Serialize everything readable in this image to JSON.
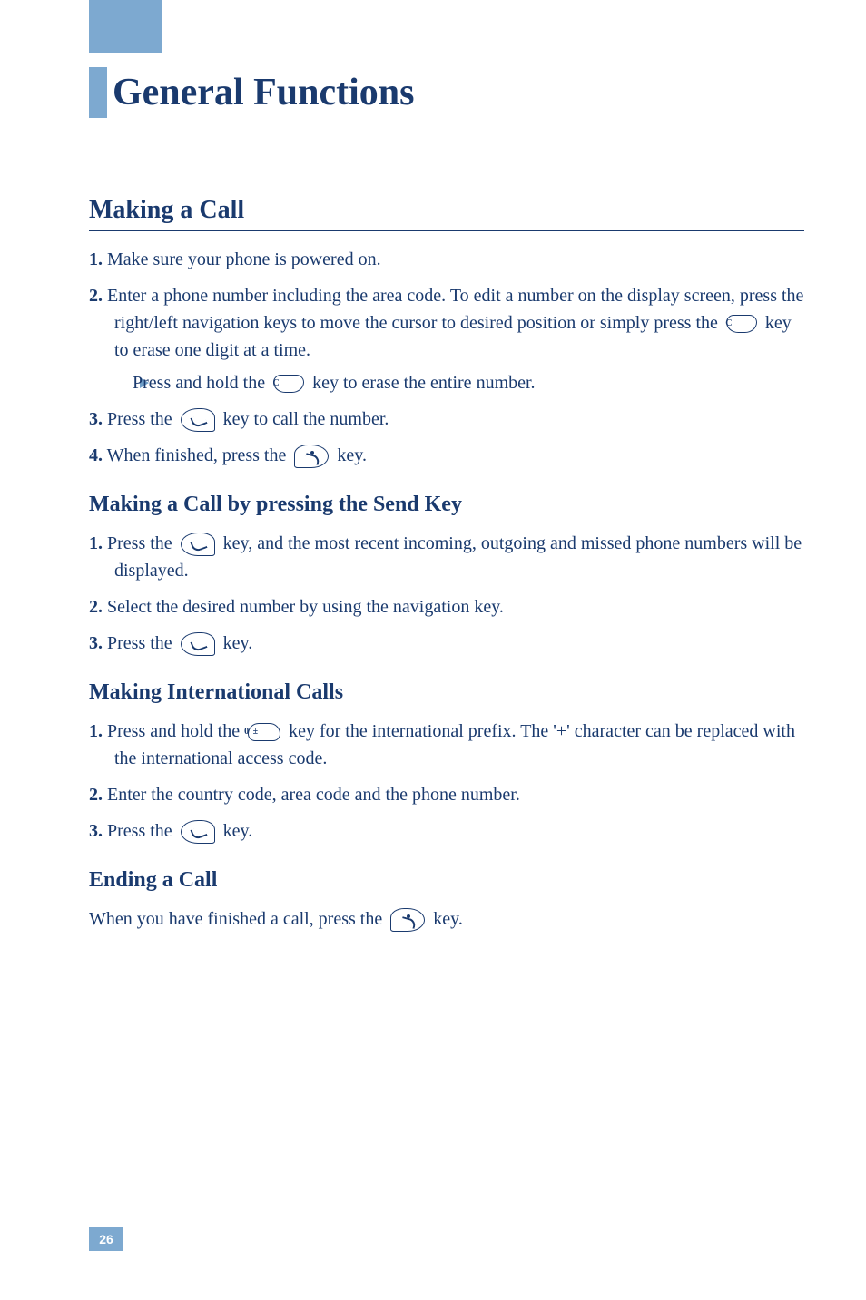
{
  "page": {
    "title": "General Functions",
    "page_number": "26"
  },
  "sections": {
    "making_call": {
      "title": "Making a Call",
      "steps": {
        "s1_num": "1.",
        "s1": " Make sure your phone is powered on.",
        "s2_num": "2.",
        "s2a": " Enter a phone number including the area code. To edit a number on the display screen, press the right/left navigation keys to move the cursor to desired position or simply press the ",
        "s2b": "  key to erase one digit at a time.",
        "s2_sub_a": "Press and hold the ",
        "s2_sub_b": "  key to erase the entire number.",
        "s3_num": "3.",
        "s3a": " Press the ",
        "s3b": "  key to call the number.",
        "s4_num": "4.",
        "s4a": " When finished, press the ",
        "s4b": "  key."
      }
    },
    "send_key": {
      "title": "Making a Call by pressing the Send Key",
      "steps": {
        "s1_num": "1.",
        "s1a": " Press the ",
        "s1b": "  key, and the most recent incoming, outgoing and missed phone numbers will be displayed.",
        "s2_num": "2.",
        "s2": " Select the desired number by using the navigation key.",
        "s3_num": "3.",
        "s3a": " Press the ",
        "s3b": " key."
      }
    },
    "international": {
      "title": "Making International Calls",
      "steps": {
        "s1_num": "1.",
        "s1a": " Press and hold the ",
        "s1b": " key for the international prefix. The '+' character can be replaced with the international access code.",
        "s2_num": "2.",
        "s2": " Enter the country code, area code and the phone number.",
        "s3_num": "3.",
        "s3a": " Press the ",
        "s3b": " key."
      }
    },
    "ending": {
      "title": "Ending a Call",
      "body_a": "When you have finished a call, press the ",
      "body_b": " key."
    }
  },
  "key_labels": {
    "c": "C",
    "zero": "0 ±"
  }
}
